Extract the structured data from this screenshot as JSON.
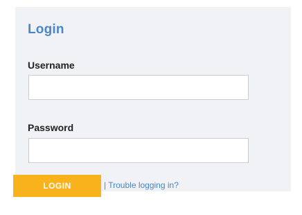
{
  "login": {
    "title": "Login",
    "username_label": "Username",
    "username_value": "",
    "password_label": "Password",
    "password_value": "",
    "login_button_label": "LOGIN",
    "separator": "|",
    "trouble_link_label": "Trouble logging in?"
  },
  "colors": {
    "accent": "#4a86c8",
    "button": "#f8b21c",
    "panel_background": "#f1f2f5"
  }
}
